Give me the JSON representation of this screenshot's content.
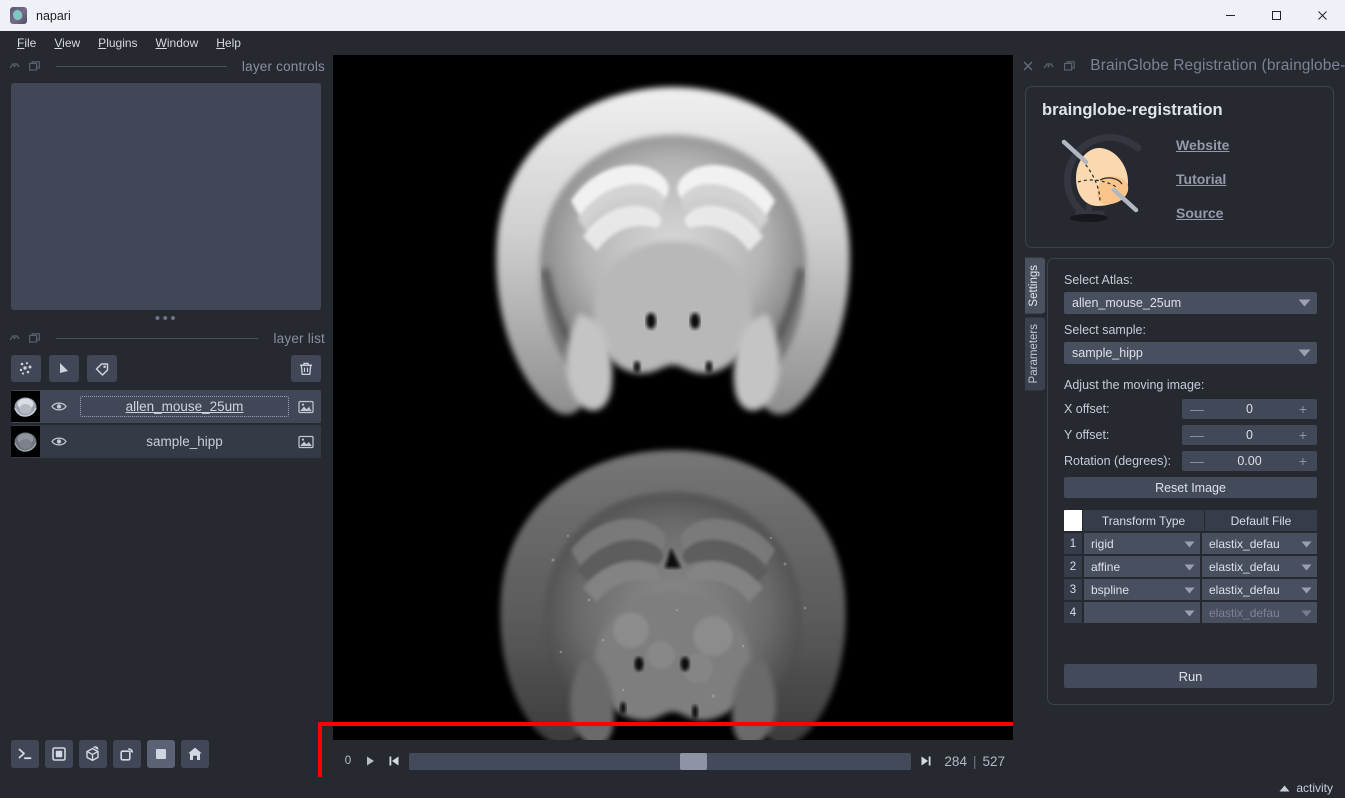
{
  "window": {
    "title": "napari",
    "app_icon": "napari-logo-icon",
    "controls": [
      {
        "name": "minimize-button",
        "glyph": "minimize-icon"
      },
      {
        "name": "maximize-button",
        "glyph": "maximize-icon"
      },
      {
        "name": "close-button",
        "glyph": "close-icon"
      }
    ]
  },
  "menubar": {
    "items": [
      {
        "mnemonic": "F",
        "rest": "ile"
      },
      {
        "mnemonic": "V",
        "rest": "iew"
      },
      {
        "mnemonic": "P",
        "rest": "lugins"
      },
      {
        "mnemonic": "W",
        "rest": "indow"
      },
      {
        "mnemonic": "H",
        "rest": "elp"
      }
    ]
  },
  "left_dock": {
    "layer_controls": {
      "title": "layer controls",
      "float_icon": "float-dock-icon",
      "popout_icon": "popout-dock-icon"
    },
    "layer_list": {
      "title": "layer list",
      "float_icon": "float-dock-icon",
      "popout_icon": "popout-dock-icon",
      "buttons": [
        {
          "name": "new-points-layer-button",
          "icon": "points-icon"
        },
        {
          "name": "new-shapes-layer-button",
          "icon": "shapes-icon"
        },
        {
          "name": "new-labels-layer-button",
          "icon": "labels-tag-icon"
        },
        {
          "name": "delete-layer-button",
          "icon": "trash-icon"
        }
      ],
      "layers": [
        {
          "name": "allen_mouse_25um",
          "visible": true,
          "selected": true,
          "editing": true,
          "type_icon": "image-layer-icon"
        },
        {
          "name": "sample_hipp",
          "visible": true,
          "selected": false,
          "editing": false,
          "type_icon": "image-layer-icon"
        }
      ]
    },
    "viewer_buttons": [
      {
        "name": "console-button",
        "icon": "console-icon",
        "active": false
      },
      {
        "name": "ndisplay-2d-button",
        "icon": "square-2d-icon",
        "active": false
      },
      {
        "name": "ndisplay-3d-button",
        "icon": "cube-3d-icon",
        "active": false
      },
      {
        "name": "roll-dims-button",
        "icon": "roll-dimensions-icon",
        "active": false
      },
      {
        "name": "transpose-dims-button",
        "icon": "transpose-dimensions-icon",
        "active": true
      },
      {
        "name": "reset-view-button",
        "icon": "home-icon",
        "active": false
      }
    ]
  },
  "canvas": {
    "layers": [
      {
        "name": "allen_mouse_25um",
        "description": "mouse brain atlas coronal section, grayscale"
      },
      {
        "name": "sample_hipp",
        "description": "sample hippocampus coronal section, grayscale"
      }
    ]
  },
  "dims_slider": {
    "min_label": "0",
    "play_icon": "play-icon",
    "first_frame_icon": "first-frame-icon",
    "last_frame_icon": "last-frame-icon",
    "current_value": "284",
    "separator": "|",
    "max_value": "527",
    "handle_percent": 53.9,
    "highlight_color": "#ff0000"
  },
  "right_dock": {
    "plugin_titlebar": {
      "close_icon": "close-icon",
      "float_icon": "float-dock-icon",
      "popout_icon": "popout-dock-icon",
      "title": "BrainGlobe Registration (brainglobe-regi"
    },
    "header_card": {
      "heading": "brainglobe-registration",
      "logo_icon": "brainglobe-globe-icon",
      "links": [
        {
          "name": "website-link",
          "label": "Website"
        },
        {
          "name": "tutorial-link",
          "label": "Tutorial"
        },
        {
          "name": "source-link",
          "label": "Source"
        }
      ]
    },
    "tabs": [
      {
        "name": "tab-settings",
        "label": "Settings",
        "active": true
      },
      {
        "name": "tab-parameters",
        "label": "Parameters",
        "active": false
      }
    ],
    "settings": {
      "atlas_label": "Select Atlas:",
      "atlas_value": "allen_mouse_25um",
      "sample_label": "Select sample:",
      "sample_value": "sample_hipp",
      "adjust_label": "Adjust the moving image:",
      "x_offset_label": "X offset:",
      "x_offset_value": "0",
      "y_offset_label": "Y offset:",
      "y_offset_value": "0",
      "rotation_label": "Rotation (degrees):",
      "rotation_value": "0.00",
      "reset_label": "Reset Image",
      "minus_glyph": "—",
      "plus_glyph": "+",
      "table": {
        "headers": [
          "",
          "Transform Type",
          "Default File"
        ],
        "rows": [
          {
            "index": "1",
            "transform_type": "rigid",
            "default_file": "elastix_defau",
            "enabled": true
          },
          {
            "index": "2",
            "transform_type": "affine",
            "default_file": "elastix_defau",
            "enabled": true
          },
          {
            "index": "3",
            "transform_type": "bspline",
            "default_file": "elastix_defau",
            "enabled": true
          },
          {
            "index": "4",
            "transform_type": "",
            "default_file": "elastix_defau",
            "enabled": false
          }
        ]
      },
      "run_label": "Run"
    }
  },
  "statusbar": {
    "activity_label": "activity",
    "activity_icon": "chevron-up-icon"
  }
}
